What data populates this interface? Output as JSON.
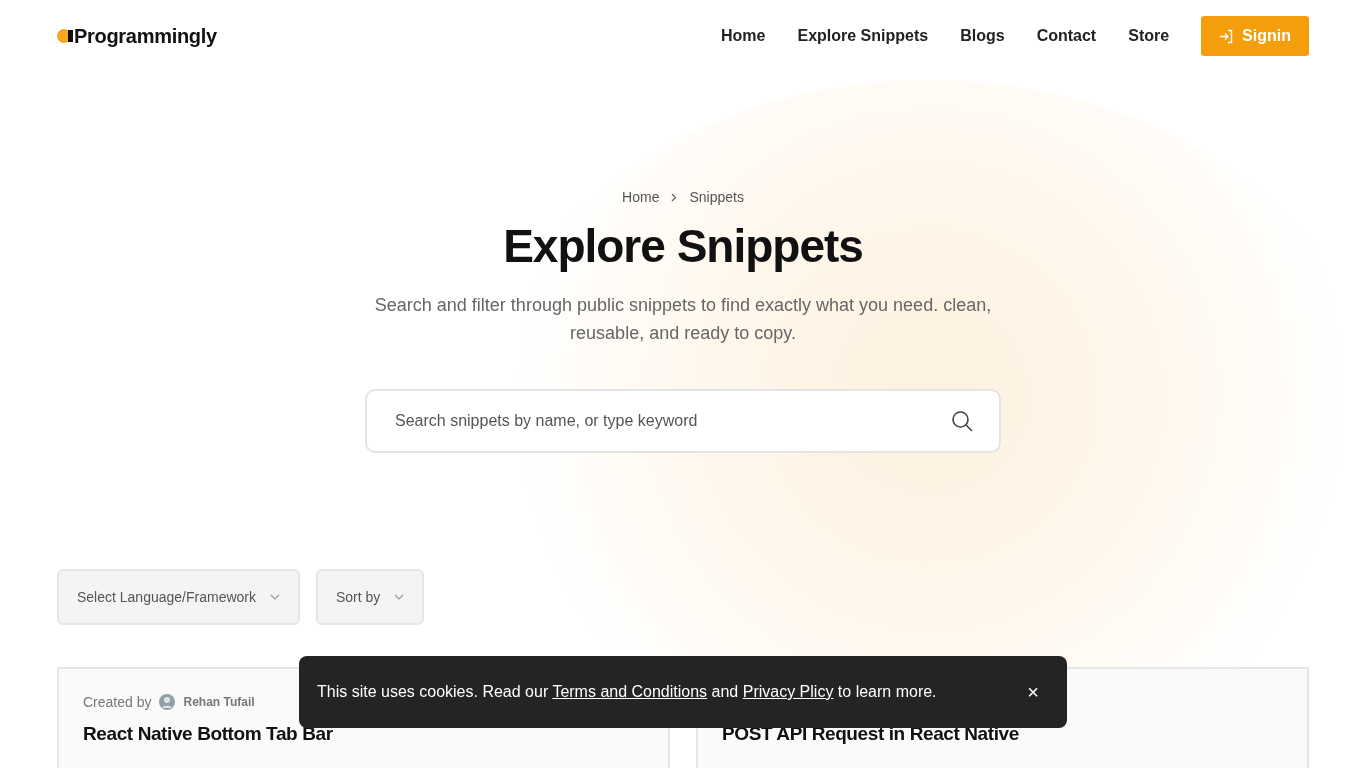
{
  "header": {
    "logo": "Programmingly",
    "nav": [
      {
        "label": "Home"
      },
      {
        "label": "Explore Snippets"
      },
      {
        "label": "Blogs"
      },
      {
        "label": "Contact"
      },
      {
        "label": "Store"
      }
    ],
    "signin": "Signin"
  },
  "hero": {
    "breadcrumb": [
      "Home",
      "Snippets"
    ],
    "title": "Explore Snippets",
    "subtitle": "Search and filter through public snippets to find exactly what you need. clean, reusable, and ready to copy.",
    "search": {
      "placeholder": "Search snippets by name, or type keyword"
    }
  },
  "filters": [
    {
      "label": "Select Language/Framework"
    },
    {
      "label": "Sort by"
    }
  ],
  "cards": [
    {
      "created_by": "Created by",
      "author": "Rehan Tufail",
      "title": "React Native Bottom Tab Bar"
    },
    {
      "title": "POST API Request in React Native"
    }
  ],
  "cookie_banner": {
    "parts": [
      {
        "kind": "text",
        "text": "This site uses cookies. Read our "
      },
      {
        "kind": "link",
        "text": "Terms and Conditions"
      },
      {
        "kind": "text",
        "text": " and "
      },
      {
        "kind": "link",
        "text": "Privacy Plicy"
      },
      {
        "kind": "text",
        "text": " to learn more."
      }
    ],
    "close": "×"
  }
}
